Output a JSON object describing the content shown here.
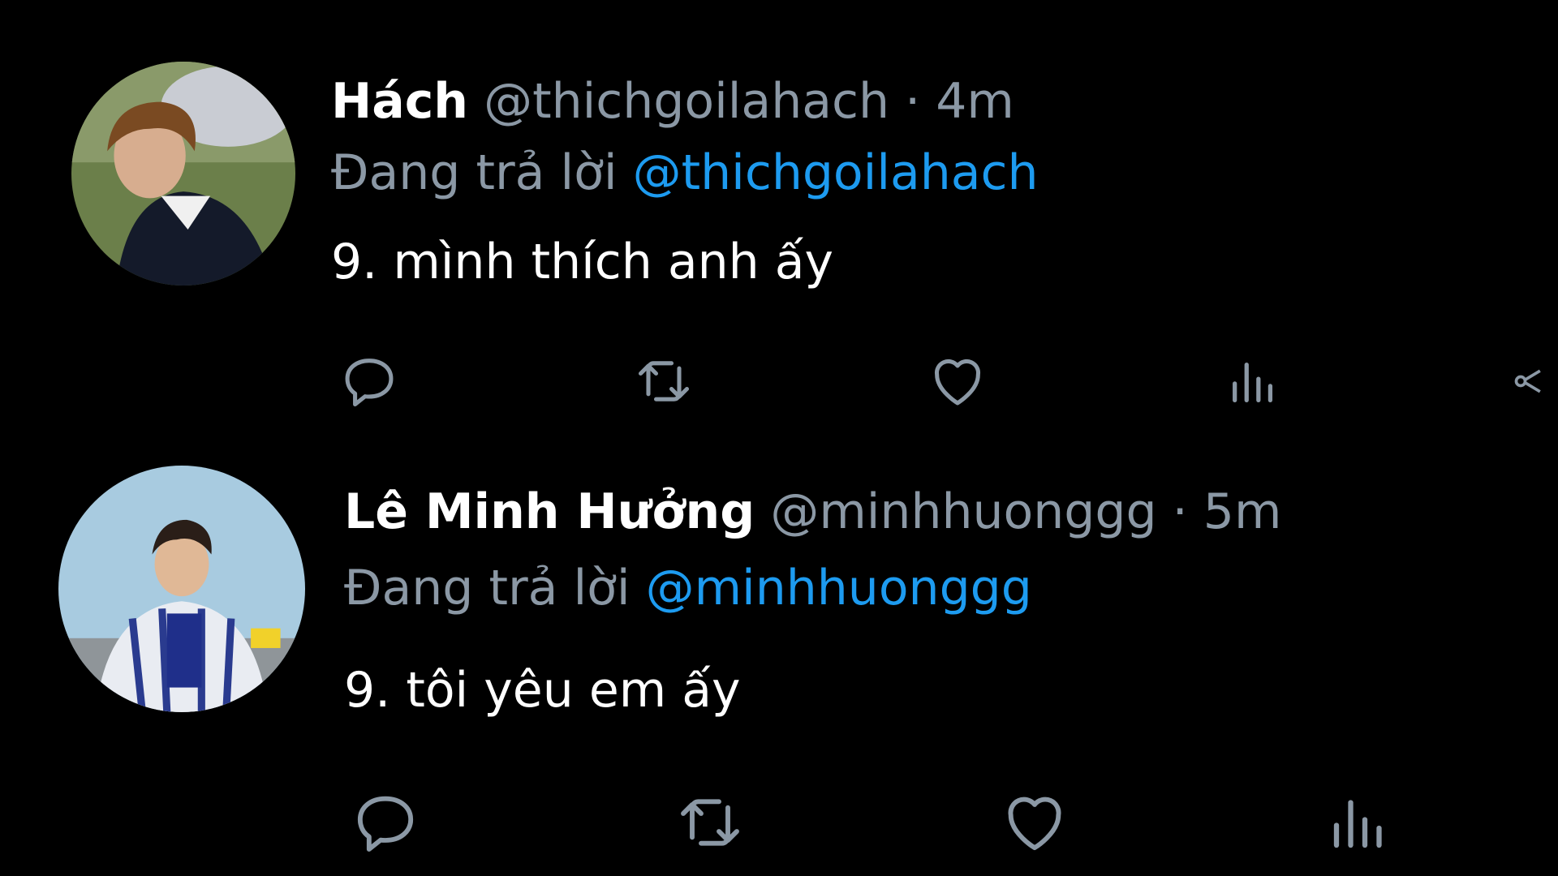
{
  "theme": {
    "background": "#000000",
    "text": "#ffffff",
    "muted": "#8b98a5",
    "accent": "#1d9bf0"
  },
  "tweets": [
    {
      "display_name": "Hách",
      "handle": "@thichgoilahach",
      "separator": "·",
      "time": "4m",
      "reply_prefix": "Đang trả lời",
      "reply_mention": "@thichgoilahach",
      "text": "9. mình thích anh ấy",
      "actions": [
        "reply-icon",
        "retweet-icon",
        "like-icon",
        "analytics-icon",
        "share-icon"
      ]
    },
    {
      "display_name": "Lê Minh Hưởng",
      "handle": "@minhhuonggg",
      "separator": "·",
      "time": "5m",
      "reply_prefix": "Đang trả lời",
      "reply_mention": "@minhhuonggg",
      "text": "9. tôi yêu em ấy",
      "actions": [
        "reply-icon",
        "retweet-icon",
        "like-icon",
        "analytics-icon"
      ]
    }
  ]
}
